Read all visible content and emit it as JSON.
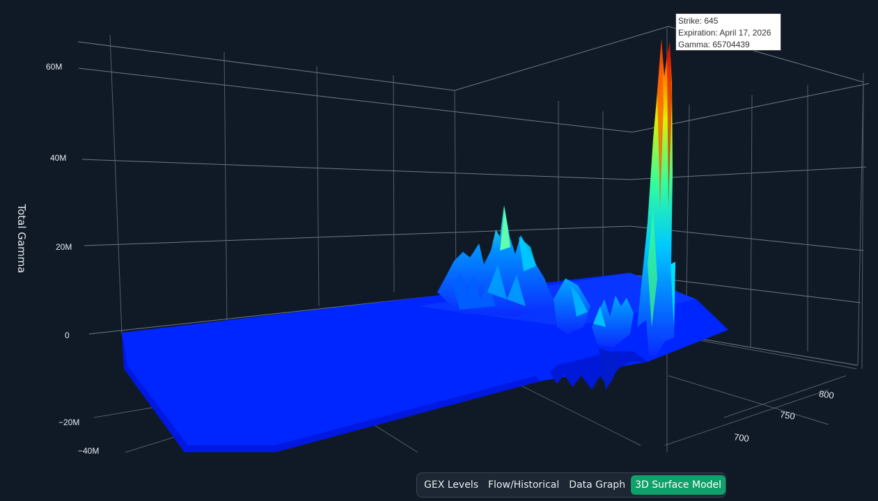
{
  "chart_data": {
    "type": "surface",
    "title": "",
    "zlabel": "Total Gamma",
    "z_ticks": [
      "60M",
      "40M",
      "20M",
      "0",
      "−20M",
      "−40M"
    ],
    "y_ticks": [
      "800",
      "750",
      "700"
    ],
    "surface_color": "#0022ff",
    "peak": {
      "strike": 645,
      "expiration": "April 17, 2026",
      "gamma": 65704439
    }
  },
  "tooltip": {
    "strike_line": "Strike: 645",
    "expiration_line": "Expiration: April 17, 2026",
    "gamma_line": "Gamma: 65704439"
  },
  "tabs": [
    {
      "label": "GEX Levels",
      "active": false
    },
    {
      "label": "Flow/Historical",
      "active": false
    },
    {
      "label": "Data Graph",
      "active": false
    },
    {
      "label": "3D Surface Model",
      "active": true
    }
  ]
}
